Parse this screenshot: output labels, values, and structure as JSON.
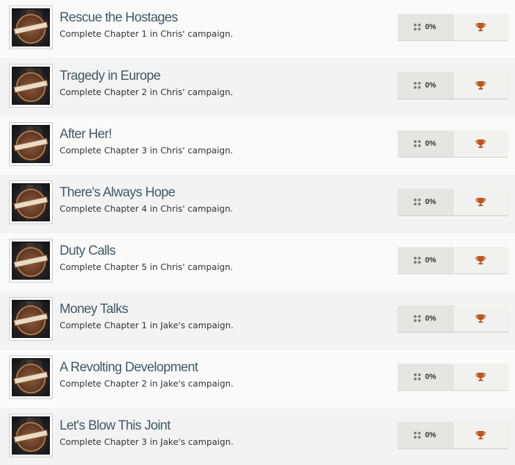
{
  "colors": {
    "title": "#3f5866",
    "trophy": "#c0551b",
    "row_even": "#f3f3f3",
    "row_odd": "#fafafa"
  },
  "achievements": [
    {
      "title": "Rescue the Hostages",
      "description": "Complete Chapter 1 in Chris' campaign.",
      "percent": "0%",
      "trophy_icon": "bronze-trophy-icon"
    },
    {
      "title": "Tragedy in Europe",
      "description": "Complete Chapter 2 in Chris' campaign.",
      "percent": "0%",
      "trophy_icon": "bronze-trophy-icon"
    },
    {
      "title": "After Her!",
      "description": "Complete Chapter 3 in Chris' campaign.",
      "percent": "0%",
      "trophy_icon": "bronze-trophy-icon"
    },
    {
      "title": "There's Always Hope",
      "description": "Complete Chapter 4 in Chris' campaign.",
      "percent": "0%",
      "trophy_icon": "bronze-trophy-icon"
    },
    {
      "title": "Duty Calls",
      "description": "Complete Chapter 5 in Chris' campaign.",
      "percent": "0%",
      "trophy_icon": "bronze-trophy-icon"
    },
    {
      "title": "Money Talks",
      "description": "Complete Chapter 1 in Jake's campaign.",
      "percent": "0%",
      "trophy_icon": "bronze-trophy-icon"
    },
    {
      "title": "A Revolting Development",
      "description": "Complete Chapter 2 in Jake's campaign.",
      "percent": "0%",
      "trophy_icon": "bronze-trophy-icon"
    },
    {
      "title": "Let's Blow This Joint",
      "description": "Complete Chapter 3 in Jake's campaign.",
      "percent": "0%",
      "trophy_icon": "bronze-trophy-icon"
    }
  ]
}
